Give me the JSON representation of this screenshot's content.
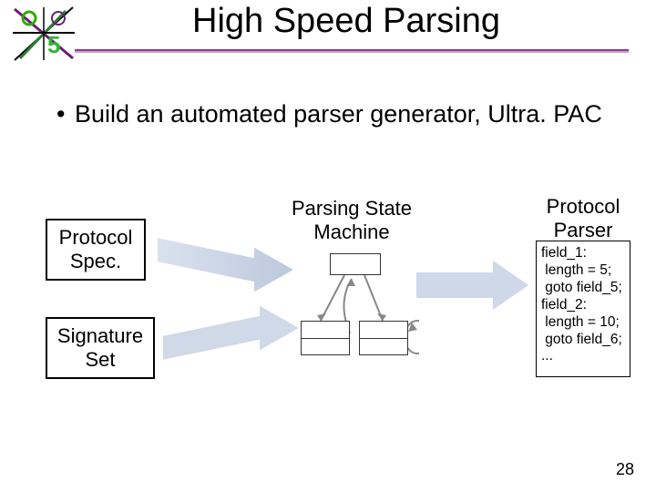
{
  "title": "High Speed Parsing",
  "bullets": {
    "b1": "Build an automated parser generator, Ultra. PAC"
  },
  "diagram": {
    "protocolSpec": "Protocol\nSpec.",
    "signatureSet": "Signature\nSet",
    "psmTitle": "Parsing State\nMachine",
    "parserTitle": "Protocol\nParser",
    "parserBody": "field_1:\n length = 5;\n goto field_5;\nfield_2:\n length = 10;\n goto field_6;\n..."
  },
  "pageNumber": "28",
  "colors": {
    "purple": "#8d3a8d"
  }
}
